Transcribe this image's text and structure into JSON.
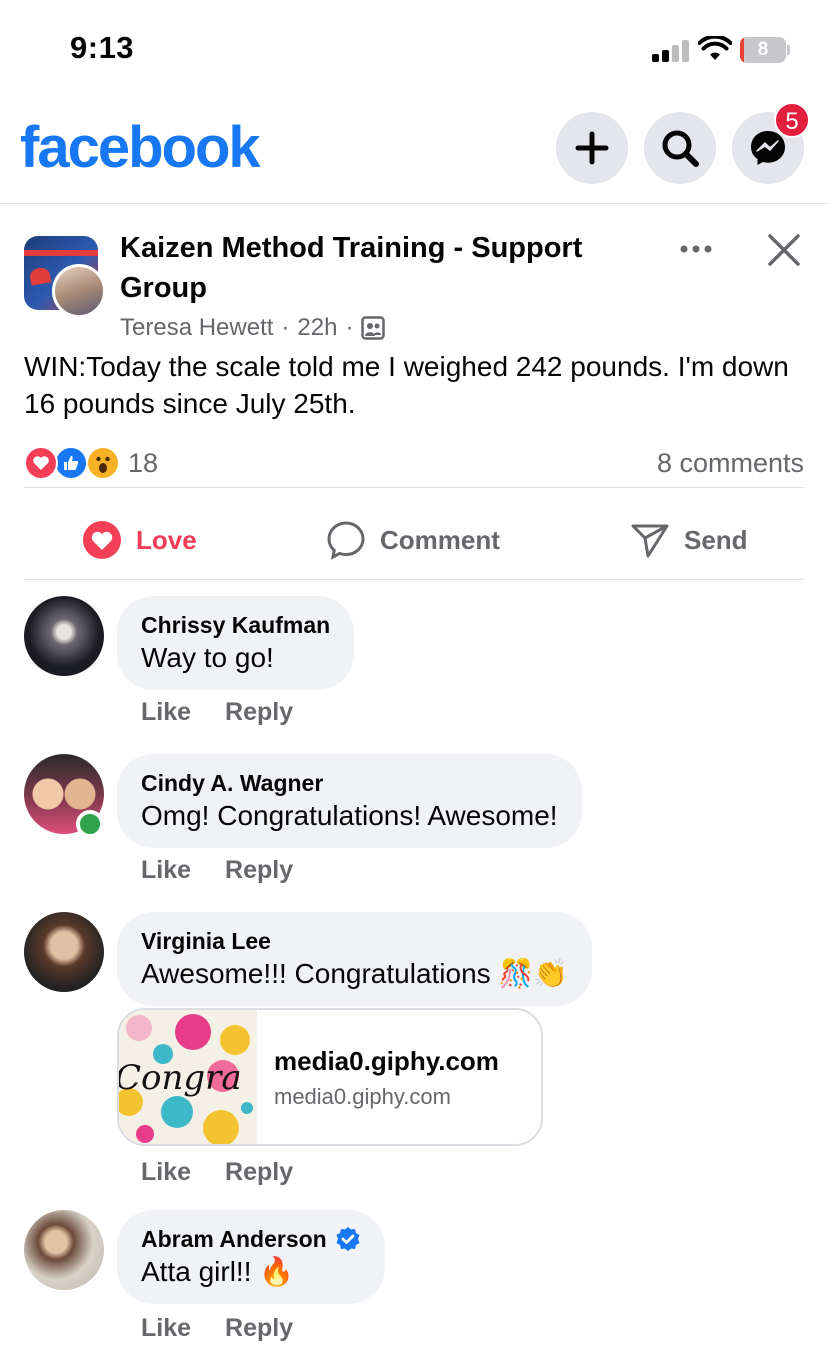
{
  "status_bar": {
    "time": "9:13",
    "battery_level": "8",
    "battery_fraction": 0.08
  },
  "header": {
    "logo": "facebook",
    "messenger_badge": "5"
  },
  "post": {
    "group_name": "Kaizen Method Training - Support Group",
    "author": "Teresa Hewett",
    "time_ago": "22h",
    "text": "WIN:Today the scale told me I weighed 242 pounds. I'm down 16 pounds since July 25th.",
    "reaction_count": "18",
    "comments_count": "8 comments",
    "reactions": [
      "love",
      "like",
      "wow"
    ]
  },
  "actions": {
    "love": "Love",
    "comment": "Comment",
    "send": "Send"
  },
  "comment_actions": {
    "like": "Like",
    "reply": "Reply"
  },
  "comments": [
    {
      "name": "Chrissy Kaufman",
      "text": "Way to go!"
    },
    {
      "name": "Cindy A. Wagner",
      "text": "Omg! Congratulations! Awesome!",
      "online": true
    },
    {
      "name": "Virginia Lee",
      "text": "Awesome!!!  Congratulations 🎊👏",
      "link": {
        "title": "media0.giphy.com",
        "domain": "media0.giphy.com",
        "thumb_text": "Congra"
      }
    },
    {
      "name": "Abram Anderson",
      "text": "Atta girl!! 🔥",
      "verified": true
    }
  ],
  "colors": {
    "brand": "#1877f2",
    "love": "#f33e58",
    "badge": "#e41e3f",
    "bubble": "#f0f2f5",
    "secondary_text": "#65676b"
  },
  "icons": [
    "plus-icon",
    "search-icon",
    "messenger-icon",
    "more-icon",
    "close-icon",
    "group-icon",
    "love-icon",
    "comment-icon",
    "send-icon",
    "verified-icon"
  ]
}
